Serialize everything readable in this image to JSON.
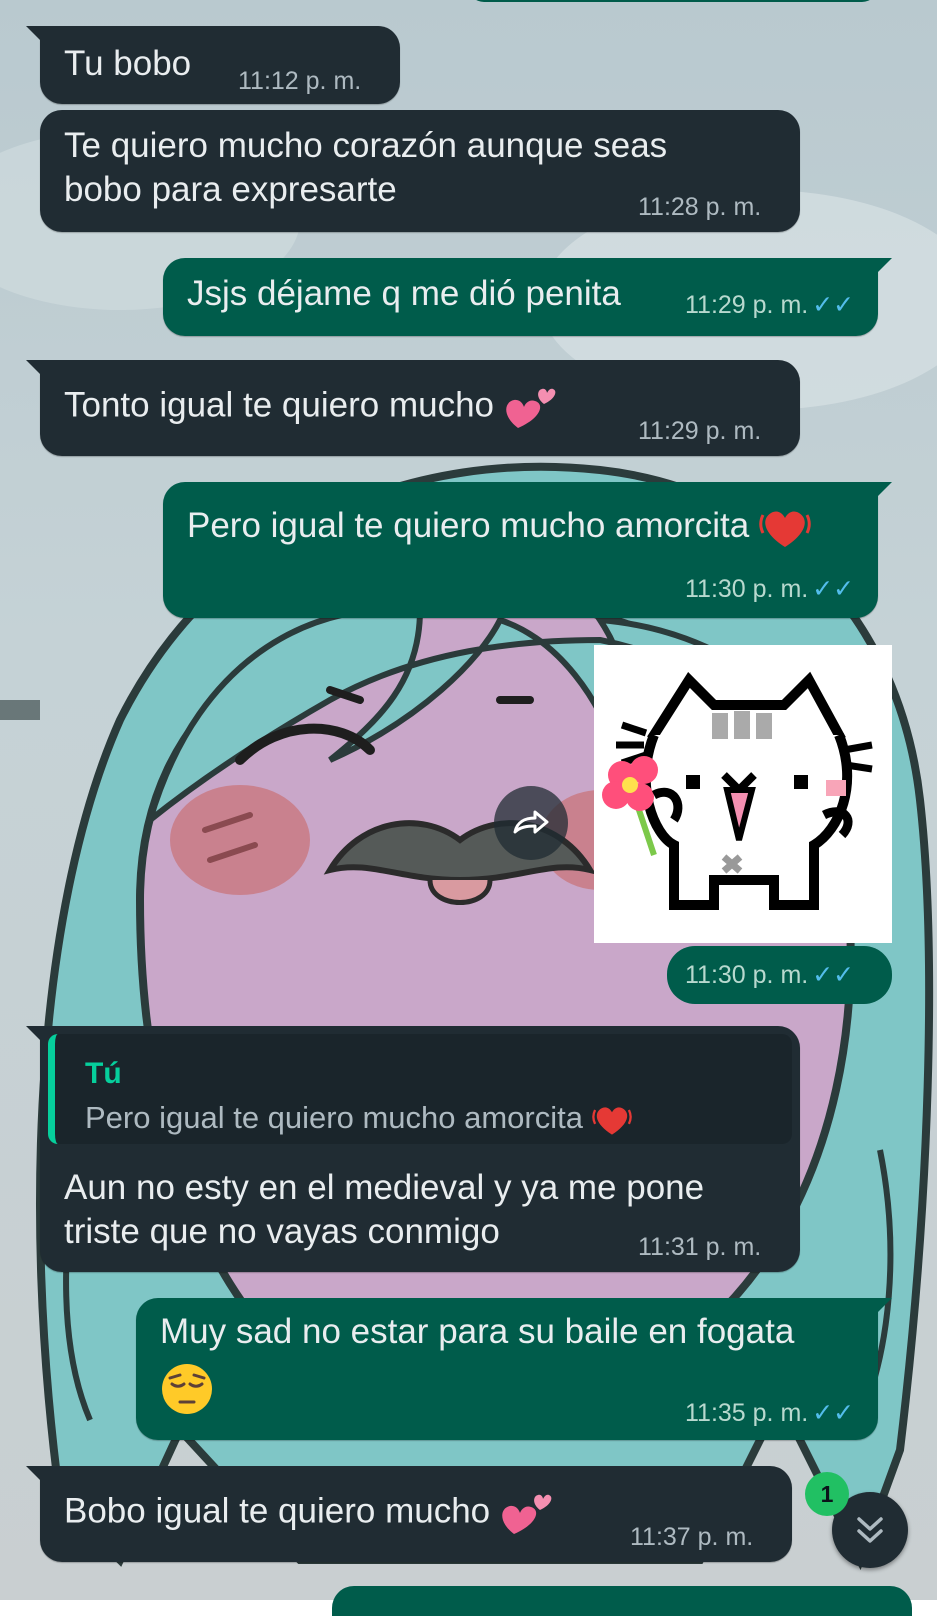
{
  "theme": {
    "incoming_bubble": "#202c33",
    "outgoing_bubble": "#005c4b",
    "read_ticks": "#53bdeb",
    "quote_accent": "#06cf9c",
    "badge": "#21c063"
  },
  "messages": [
    {
      "direction": "in",
      "text": "Tu bobo",
      "time": "11:12 p. m."
    },
    {
      "direction": "in",
      "lines": [
        "Te quiero mucho corazón aunque seas",
        "bobo para expresarte"
      ],
      "time": "11:28 p. m."
    },
    {
      "direction": "out",
      "text": "Jsjs déjame q me dió penita",
      "time": "11:29 p. m.",
      "status": "read"
    },
    {
      "direction": "in",
      "text": "Tonto igual te quiero mucho",
      "emoji": "two-hearts",
      "time": "11:29 p. m."
    },
    {
      "direction": "out",
      "text": "Pero igual te quiero mucho amorcita",
      "emoji": "beating-heart",
      "time": "11:30 p. m.",
      "status": "read"
    },
    {
      "direction": "out",
      "type": "sticker",
      "sticker": "white-cat-holding-flower",
      "time": "11:30 p. m.",
      "status": "read"
    },
    {
      "direction": "in",
      "quote": {
        "author": "Tú",
        "text": "Pero igual te quiero mucho amorcita",
        "emoji": "beating-heart"
      },
      "lines": [
        "Aun no esty en el medieval y ya me pone",
        "triste que no vayas conmigo"
      ],
      "time": "11:31 p. m."
    },
    {
      "direction": "out",
      "text": "Muy sad no estar para su baile en fogata",
      "emoji": "pensive-face",
      "time": "11:35 p. m.",
      "status": "read"
    },
    {
      "direction": "in",
      "text": "Bobo igual te quiero mucho",
      "emoji": "two-hearts",
      "time": "11:37 p. m."
    }
  ],
  "tick_glyph": "✓✓",
  "scroll_down": {
    "unread_count": "1",
    "icon": "double-chevron-down-icon"
  },
  "forward_icon": "forward-icon"
}
